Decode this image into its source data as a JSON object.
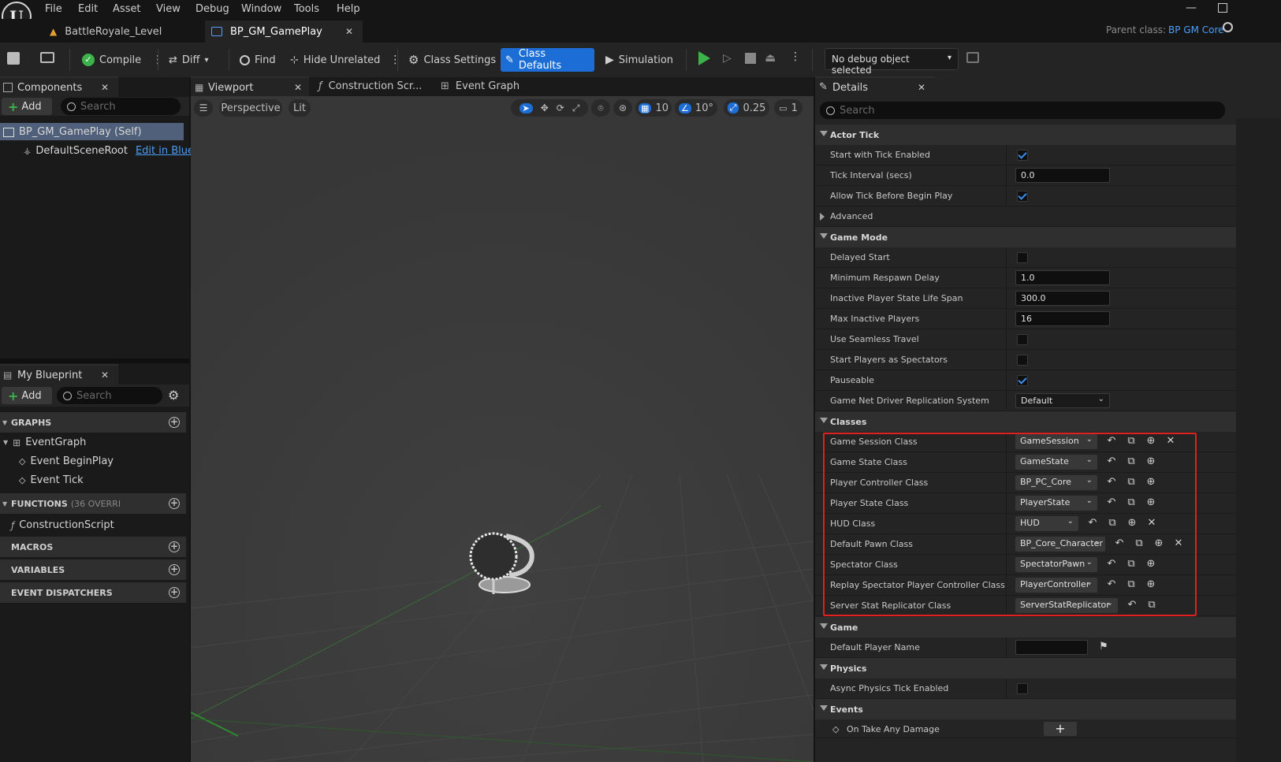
{
  "menu": [
    "File",
    "Edit",
    "Asset",
    "View",
    "Debug",
    "Window",
    "Tools",
    "Help"
  ],
  "tabs": {
    "level": "BattleRoyale_Level",
    "blueprint": "BP_GM_GamePlay"
  },
  "parent": {
    "label": "Parent class:",
    "value": "BP GM Core"
  },
  "toolbar": {
    "compile": "Compile",
    "diff": "Diff",
    "find": "Find",
    "hide_unrelated": "Hide Unrelated",
    "class_settings": "Class Settings",
    "class_defaults": "Class Defaults",
    "simulation": "Simulation",
    "debug": "No debug object selected"
  },
  "components": {
    "tab": "Components",
    "add": "Add",
    "search": "Search",
    "self": "BP_GM_GamePlay (Self)",
    "root": "DefaultSceneRoot",
    "edit": "Edit in Bluepri"
  },
  "myblueprint": {
    "tab": "My Blueprint",
    "add": "Add",
    "search": "Search",
    "graphs": "GRAPHS",
    "eventgraph": "EventGraph",
    "beginplay": "Event BeginPlay",
    "tick": "Event Tick",
    "functions": "FUNCTIONS",
    "overrides": "(36 OVERRI",
    "construction": "ConstructionScript",
    "macros": "MACROS",
    "variables": "VARIABLES",
    "dispatchers": "EVENT DISPATCHERS"
  },
  "viewport": {
    "tabs": [
      "Viewport",
      "Construction Scr...",
      "Event Graph"
    ],
    "perspective": "Perspective",
    "lit": "Lit",
    "grid": "10",
    "angle": "10°",
    "scale": "0.25",
    "camera": "1"
  },
  "details": {
    "tab": "Details",
    "search": "Search",
    "actor_tick": "Actor Tick",
    "start_tick": {
      "label": "Start with Tick Enabled",
      "checked": true
    },
    "tick_interval": {
      "label": "Tick Interval (secs)",
      "value": "0.0"
    },
    "allow_tick": {
      "label": "Allow Tick Before Begin Play",
      "checked": true
    },
    "advanced": "Advanced",
    "game_mode": "Game Mode",
    "delayed_start": {
      "label": "Delayed Start",
      "checked": false
    },
    "min_respawn": {
      "label": "Minimum Respawn Delay",
      "value": "1.0"
    },
    "inactive_life": {
      "label": "Inactive Player State Life Span",
      "value": "300.0"
    },
    "max_inactive": {
      "label": "Max Inactive Players",
      "value": "16"
    },
    "seamless": {
      "label": "Use Seamless Travel",
      "checked": false
    },
    "spectators": {
      "label": "Start Players as Spectators",
      "checked": false
    },
    "pauseable": {
      "label": "Pauseable",
      "checked": true
    },
    "net_driver": {
      "label": "Game Net Driver Replication System",
      "value": "Default"
    },
    "classes": "Classes",
    "class_rows": [
      {
        "label": "Game Session Class",
        "value": "GameSession"
      },
      {
        "label": "Game State Class",
        "value": "GameState"
      },
      {
        "label": "Player Controller Class",
        "value": "BP_PC_Core"
      },
      {
        "label": "Player State Class",
        "value": "PlayerState"
      },
      {
        "label": "HUD Class",
        "value": "HUD"
      },
      {
        "label": "Default Pawn Class",
        "value": "BP_Core_Character"
      },
      {
        "label": "Spectator Class",
        "value": "SpectatorPawn"
      },
      {
        "label": "Replay Spectator Player Controller Class",
        "value": "PlayerController"
      },
      {
        "label": "Server Stat Replicator Class",
        "value": "ServerStatReplicator"
      }
    ],
    "game": "Game",
    "player_name": {
      "label": "Default Player Name",
      "value": ""
    },
    "physics": "Physics",
    "async_physics": {
      "label": "Async Physics Tick Enabled",
      "checked": false
    },
    "events": "Events",
    "take_damage": "On Take Any Damage"
  },
  "colors": {
    "accent": "#1c6ed6",
    "highlight": "#e02020",
    "link": "#4a9ef8"
  }
}
